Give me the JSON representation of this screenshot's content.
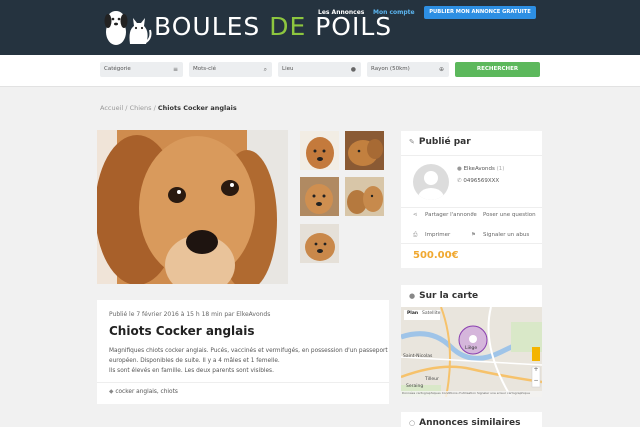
{
  "header": {
    "logo_parts": [
      "BOULES ",
      "DE",
      " POILS"
    ],
    "nav": [
      "Les Annonces",
      "Mon compte"
    ],
    "publish_label": "PUBLIER MON ANNONCE GRATUITE"
  },
  "search": {
    "category_placeholder": "Catégorie",
    "keywords_placeholder": "Mots-clé",
    "location_placeholder": "Lieu",
    "radius_placeholder": "Rayon (50km)",
    "button_label": "RECHERCHER"
  },
  "breadcrumb": [
    "Accueil",
    "Chiens",
    "Chiots Cocker anglais"
  ],
  "listing": {
    "published": "Publié le 7 février 2016 à 15 h 18 min par ElkeAvonds",
    "title": "Chiots Cocker anglais",
    "description": [
      "Magnifiques chiots cocker anglais. Pucés, vaccinés et vermifugés, en possession d'un passeport",
      "européen. Disponibles de suite. Il y a 4 mâles et 1 femelle.",
      "Ils sont élevés en famille. Les deux parents sont visibles."
    ],
    "tags": "cocker anglais, chiots"
  },
  "publisher": {
    "heading": "Publié par",
    "name": "ElkeAvonds",
    "count": "(1)",
    "phone": "0496569XXX",
    "actions": [
      "Partager l'annonce",
      "Poser une question",
      "Imprimer",
      "Signaler un abus"
    ],
    "price": "500.00€"
  },
  "map_card": {
    "heading": "Sur la carte",
    "map_types": [
      "Plan",
      "Satellite"
    ],
    "places": [
      "Liège",
      "Saint-Nicolas",
      "Tilleur",
      "Seraing"
    ],
    "credits": [
      "Données cartographiques",
      "Conditions d'utilisation",
      "Signaler une erreur cartographique"
    ]
  },
  "similar_card": {
    "heading": "Annonces similaires"
  },
  "colors": {
    "header_bg": "#25333f",
    "accent_green": "#8dc63f",
    "publish_blue": "#2d8fe3",
    "search_green": "#5cb85c",
    "price_orange": "#f0a830"
  }
}
